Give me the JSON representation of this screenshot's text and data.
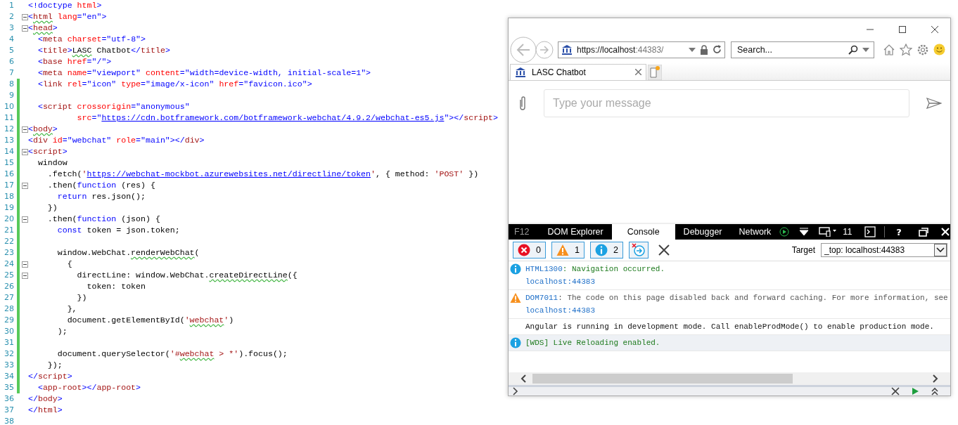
{
  "editor": {
    "lines": [
      {
        "number": "1",
        "changed": false,
        "fold": false,
        "tokens": [
          {
            "kind": "punc",
            "text": "<!doctype "
          },
          {
            "kind": "attr",
            "text": "html"
          },
          {
            "kind": "punc",
            "text": ">"
          }
        ]
      },
      {
        "number": "2",
        "changed": false,
        "fold": true,
        "tokens": [
          {
            "kind": "punc",
            "text": "<"
          },
          {
            "kind": "tag",
            "text": "html",
            "squiggle": true
          },
          {
            "kind": "attr",
            "text": " lang"
          },
          {
            "kind": "punc",
            "text": "=\"en\">"
          }
        ]
      },
      {
        "number": "3",
        "changed": false,
        "fold": true,
        "tokens": [
          {
            "kind": "punc",
            "text": "<"
          },
          {
            "kind": "tag",
            "text": "head",
            "squiggle": true
          },
          {
            "kind": "punc",
            "text": ">"
          }
        ]
      },
      {
        "number": "4",
        "changed": false,
        "fold": false,
        "tokens": [
          {
            "kind": "punc",
            "text": "  <"
          },
          {
            "kind": "tag",
            "text": "meta"
          },
          {
            "kind": "attr",
            "text": " charset"
          },
          {
            "kind": "punc",
            "text": "=\"utf-8\">"
          }
        ]
      },
      {
        "number": "5",
        "changed": false,
        "fold": false,
        "tokens": [
          {
            "kind": "punc",
            "text": "  <"
          },
          {
            "kind": "tag",
            "text": "title"
          },
          {
            "kind": "punc",
            "text": ">"
          },
          {
            "kind": "txt",
            "text": "LASC",
            "squiggle": true
          },
          {
            "kind": "txt",
            "text": " Chatbot"
          },
          {
            "kind": "punc",
            "text": "</"
          },
          {
            "kind": "tag",
            "text": "title"
          },
          {
            "kind": "punc",
            "text": ">"
          }
        ]
      },
      {
        "number": "6",
        "changed": false,
        "fold": false,
        "tokens": [
          {
            "kind": "punc",
            "text": "  <"
          },
          {
            "kind": "tag",
            "text": "base"
          },
          {
            "kind": "attr",
            "text": " href"
          },
          {
            "kind": "punc",
            "text": "=\"/\">"
          }
        ]
      },
      {
        "number": "7",
        "changed": false,
        "fold": false,
        "tokens": [
          {
            "kind": "punc",
            "text": "  <"
          },
          {
            "kind": "tag",
            "text": "meta"
          },
          {
            "kind": "attr",
            "text": " name"
          },
          {
            "kind": "punc",
            "text": "=\"viewport\" "
          },
          {
            "kind": "attr",
            "text": "content"
          },
          {
            "kind": "punc",
            "text": "=\"width=device-width, initial-scale=1\">"
          }
        ]
      },
      {
        "number": "8",
        "changed": true,
        "fold": false,
        "tokens": [
          {
            "kind": "punc",
            "text": "  <"
          },
          {
            "kind": "tag",
            "text": "link"
          },
          {
            "kind": "attr",
            "text": " rel"
          },
          {
            "kind": "punc",
            "text": "=\"icon\" "
          },
          {
            "kind": "attr",
            "text": "type"
          },
          {
            "kind": "punc",
            "text": "=\"image/x-icon\" "
          },
          {
            "kind": "attr",
            "text": "href"
          },
          {
            "kind": "punc",
            "text": "=\"favicon.ico\">"
          }
        ]
      },
      {
        "number": "9",
        "changed": true,
        "fold": false
      },
      {
        "number": "10",
        "changed": true,
        "fold": false,
        "tokens": [
          {
            "kind": "punc",
            "text": "  <"
          },
          {
            "kind": "tag",
            "text": "script"
          },
          {
            "kind": "attr",
            "text": " crossorigin"
          },
          {
            "kind": "punc",
            "text": "=\"anonymous\""
          }
        ]
      },
      {
        "number": "11",
        "changed": true,
        "fold": false,
        "tokens": [
          {
            "kind": "attr",
            "text": "          src"
          },
          {
            "kind": "punc",
            "text": "=\""
          },
          {
            "kind": "link",
            "text": "https://cdn.botframework.com/botframework-webchat/4.9.2/webchat-es5.js"
          },
          {
            "kind": "punc",
            "text": "\"></"
          },
          {
            "kind": "tag",
            "text": "script"
          },
          {
            "kind": "punc",
            "text": ">"
          }
        ]
      },
      {
        "number": "12",
        "changed": true,
        "fold": true,
        "tokens": [
          {
            "kind": "punc",
            "text": "<"
          },
          {
            "kind": "tag",
            "text": "body",
            "squiggle": true
          },
          {
            "kind": "punc",
            "text": ">"
          }
        ]
      },
      {
        "number": "13",
        "changed": true,
        "fold": false,
        "tokens": [
          {
            "kind": "punc",
            "text": "<"
          },
          {
            "kind": "tag",
            "text": "div"
          },
          {
            "kind": "attr",
            "text": " id"
          },
          {
            "kind": "punc",
            "text": "=\"webchat\" "
          },
          {
            "kind": "attr",
            "text": "role"
          },
          {
            "kind": "punc",
            "text": "=\"main\"></"
          },
          {
            "kind": "tag",
            "text": "div"
          },
          {
            "kind": "punc",
            "text": ">"
          }
        ]
      },
      {
        "number": "14",
        "changed": true,
        "fold": true,
        "tokens": [
          {
            "kind": "punc",
            "text": "<"
          },
          {
            "kind": "tag",
            "text": "script"
          },
          {
            "kind": "punc",
            "text": ">"
          }
        ]
      },
      {
        "number": "15",
        "changed": true,
        "fold": false,
        "tokens": [
          {
            "kind": "txt",
            "text": "  window"
          }
        ]
      },
      {
        "number": "16",
        "changed": true,
        "fold": false,
        "tokens": [
          {
            "kind": "txt",
            "text": "    .fetch("
          },
          {
            "kind": "jstr",
            "text": "'"
          },
          {
            "kind": "link",
            "text": "https://webchat-mockbot.azurewebsites.net/directline/token"
          },
          {
            "kind": "jstr",
            "text": "'"
          },
          {
            "kind": "txt",
            "text": ", { method: "
          },
          {
            "kind": "jstr",
            "text": "'POST'"
          },
          {
            "kind": "txt",
            "text": " })"
          }
        ]
      },
      {
        "number": "17",
        "changed": true,
        "fold": true,
        "tokens": [
          {
            "kind": "txt",
            "text": "    .then("
          },
          {
            "kind": "kw",
            "text": "function"
          },
          {
            "kind": "txt",
            "text": " (res) {"
          }
        ]
      },
      {
        "number": "18",
        "changed": true,
        "fold": false,
        "tokens": [
          {
            "kind": "kw",
            "text": "      return"
          },
          {
            "kind": "txt",
            "text": " res.json();"
          }
        ]
      },
      {
        "number": "19",
        "changed": true,
        "fold": false,
        "tokens": [
          {
            "kind": "txt",
            "text": "    })"
          }
        ]
      },
      {
        "number": "20",
        "changed": true,
        "fold": true,
        "tokens": [
          {
            "kind": "txt",
            "text": "    .then("
          },
          {
            "kind": "kw",
            "text": "function"
          },
          {
            "kind": "txt",
            "text": " (json) {"
          }
        ]
      },
      {
        "number": "21",
        "changed": true,
        "fold": false,
        "tokens": [
          {
            "kind": "kw",
            "text": "      const"
          },
          {
            "kind": "txt",
            "text": " token = json.token;"
          }
        ]
      },
      {
        "number": "22",
        "changed": true,
        "fold": false
      },
      {
        "number": "23",
        "changed": true,
        "fold": false,
        "tokens": [
          {
            "kind": "txt",
            "text": "      window.WebChat."
          },
          {
            "kind": "txt",
            "text": "renderWebChat",
            "squiggle": true
          },
          {
            "kind": "txt",
            "text": "("
          }
        ]
      },
      {
        "number": "24",
        "changed": true,
        "fold": true,
        "tokens": [
          {
            "kind": "txt",
            "text": "        {"
          }
        ]
      },
      {
        "number": "25",
        "changed": true,
        "fold": true,
        "tokens": [
          {
            "kind": "txt",
            "text": "          directLine: window.WebChat."
          },
          {
            "kind": "txt",
            "text": "createDirectLine",
            "squiggle": true
          },
          {
            "kind": "txt",
            "text": "({"
          }
        ]
      },
      {
        "number": "26",
        "changed": true,
        "fold": false,
        "tokens": [
          {
            "kind": "txt",
            "text": "            token: token"
          }
        ]
      },
      {
        "number": "27",
        "changed": true,
        "fold": false,
        "tokens": [
          {
            "kind": "txt",
            "text": "          })"
          }
        ]
      },
      {
        "number": "28",
        "changed": true,
        "fold": false,
        "tokens": [
          {
            "kind": "txt",
            "text": "        },"
          }
        ]
      },
      {
        "number": "29",
        "changed": true,
        "fold": false,
        "tokens": [
          {
            "kind": "txt",
            "text": "        document.getElementById("
          },
          {
            "kind": "jstr",
            "text": "'"
          },
          {
            "kind": "jstr",
            "text": "webchat",
            "squiggle": true
          },
          {
            "kind": "jstr",
            "text": "'"
          },
          {
            "kind": "txt",
            "text": ")"
          }
        ]
      },
      {
        "number": "30",
        "changed": true,
        "fold": false,
        "tokens": [
          {
            "kind": "txt",
            "text": "      );"
          }
        ]
      },
      {
        "number": "31",
        "changed": true,
        "fold": false
      },
      {
        "number": "32",
        "changed": true,
        "fold": false,
        "tokens": [
          {
            "kind": "txt",
            "text": "      document.querySelector("
          },
          {
            "kind": "jstr",
            "text": "'#"
          },
          {
            "kind": "jstr",
            "text": "webchat",
            "squiggle": true
          },
          {
            "kind": "jstr",
            "text": " > *'"
          },
          {
            "kind": "txt",
            "text": ").focus();"
          }
        ]
      },
      {
        "number": "33",
        "changed": true,
        "fold": false,
        "tokens": [
          {
            "kind": "txt",
            "text": "    });"
          }
        ]
      },
      {
        "number": "34",
        "changed": true,
        "fold": false,
        "tokens": [
          {
            "kind": "punc",
            "text": "</"
          },
          {
            "kind": "tag",
            "text": "script"
          },
          {
            "kind": "punc",
            "text": ">"
          }
        ]
      },
      {
        "number": "35",
        "changed": true,
        "fold": false,
        "tokens": [
          {
            "kind": "punc",
            "text": "  <"
          },
          {
            "kind": "tag",
            "text": "app-root"
          },
          {
            "kind": "punc",
            "text": "></"
          },
          {
            "kind": "tag",
            "text": "app-root"
          },
          {
            "kind": "punc",
            "text": ">"
          }
        ]
      },
      {
        "number": "36",
        "changed": false,
        "fold": false,
        "tokens": [
          {
            "kind": "punc",
            "text": "</"
          },
          {
            "kind": "tag",
            "text": "body"
          },
          {
            "kind": "punc",
            "text": ">"
          }
        ]
      },
      {
        "number": "37",
        "changed": false,
        "fold": false,
        "tokens": [
          {
            "kind": "punc",
            "text": "</"
          },
          {
            "kind": "tag",
            "text": "html"
          },
          {
            "kind": "punc",
            "text": ">"
          }
        ]
      },
      {
        "number": "38",
        "changed": false,
        "fold": false
      }
    ]
  },
  "browser": {
    "address_main": "https://localhost",
    "address_rest": ":44383/",
    "search": {
      "placeholder": "Search..."
    },
    "tabs": [
      {
        "title": "LASC Chatbot",
        "selected": true
      }
    ],
    "chat": {
      "placeholder": "Type your message"
    },
    "devtools": {
      "f12": "F12",
      "tabs": [
        {
          "label": "DOM Explorer",
          "selected": false
        },
        {
          "label": "Console",
          "selected": true
        },
        {
          "label": "Debugger",
          "selected": false
        },
        {
          "label": "Network",
          "selected": false
        }
      ],
      "emulation_count": "11",
      "help": "?",
      "filters": [
        {
          "kind": "error",
          "count": "0",
          "selected": true
        },
        {
          "kind": "warning",
          "count": "1",
          "selected": true
        },
        {
          "kind": "info",
          "count": "2",
          "selected": true
        }
      ],
      "target_label": "Target",
      "target_value": "_top: localhost:44383",
      "entries": [
        {
          "kind": "info",
          "code": "HTML1300",
          "message": ": Navigation occurred.",
          "source": "localhost:44383",
          "selected": false
        },
        {
          "kind": "warning",
          "code": "DOM7011",
          "message": ": The code on this page disabled back and forward caching. For more information, see",
          "source": "localhost:44383",
          "selected": false
        },
        {
          "kind": "log",
          "message": "Angular is running in development mode. Call enableProdMode() to enable production mode.",
          "selected": false
        },
        {
          "kind": "info",
          "message": "[WDS] Live Reloading enabled.",
          "selected": true
        }
      ]
    }
  }
}
